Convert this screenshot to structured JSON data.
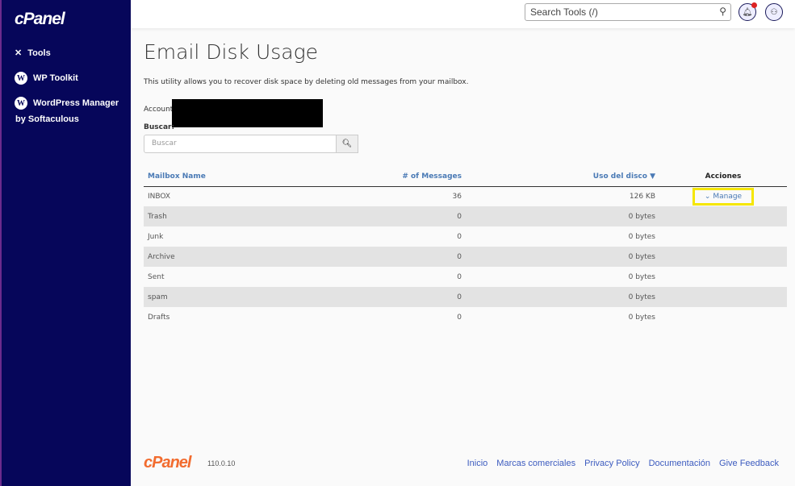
{
  "sidebar": {
    "logo": "cPanel",
    "items": [
      {
        "label": "Tools"
      },
      {
        "label": "WP Toolkit"
      },
      {
        "label": "WordPress Manager"
      },
      {
        "label": "by Softaculous"
      }
    ]
  },
  "header": {
    "search_placeholder": "Search Tools (/)"
  },
  "page": {
    "title": "Email Disk Usage",
    "description": "This utility allows you to recover disk space by deleting old messages from your mailbox.",
    "account_label": "Account",
    "search_label": "Buscar:",
    "search_placeholder": "Buscar"
  },
  "table": {
    "headers": [
      "Mailbox Name",
      "# of Messages",
      "Uso del disco ▼",
      "Acciones"
    ],
    "manage_label": "Manage",
    "rows": [
      {
        "name": "INBOX",
        "messages": "36",
        "usage": "126 KB"
      },
      {
        "name": "Trash",
        "messages": "0",
        "usage": "0 bytes"
      },
      {
        "name": "Junk",
        "messages": "0",
        "usage": "0 bytes"
      },
      {
        "name": "Archive",
        "messages": "0",
        "usage": "0 bytes"
      },
      {
        "name": "Sent",
        "messages": "0",
        "usage": "0 bytes"
      },
      {
        "name": "spam",
        "messages": "0",
        "usage": "0 bytes"
      },
      {
        "name": "Drafts",
        "messages": "0",
        "usage": "0 bytes"
      }
    ]
  },
  "footer": {
    "logo": "cPanel",
    "version": "110.0.10",
    "links": [
      "Inicio",
      "Marcas comerciales",
      "Privacy Policy",
      "Documentación",
      "Give Feedback"
    ]
  }
}
